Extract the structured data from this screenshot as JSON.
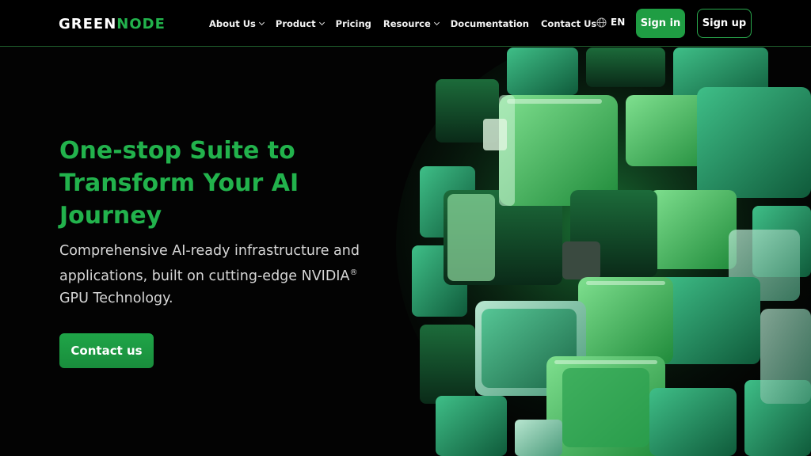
{
  "brand": {
    "logo_part1": "GREEN",
    "logo_part2": "NODE"
  },
  "nav": {
    "items": [
      {
        "label": "About Us",
        "dropdown": true
      },
      {
        "label": "Product",
        "dropdown": true
      },
      {
        "label": "Pricing",
        "dropdown": false
      },
      {
        "label": "Resource",
        "dropdown": true
      },
      {
        "label": "Documentation",
        "dropdown": false
      },
      {
        "label": "Contact Us",
        "dropdown": false
      }
    ]
  },
  "header": {
    "language": "EN",
    "signin_label": "Sign in",
    "signup_label": "Sign up"
  },
  "hero": {
    "title": "One-stop Suite to Transform Your AI Journey",
    "description_line1": "Comprehensive AI-ready infrastructure and",
    "description_line2": "applications, built on cutting-edge NVIDIA",
    "registered_mark": "®",
    "description_line3": "GPU Technology.",
    "cta_label": "Contact us"
  },
  "icons": {
    "language": "globe-icon",
    "dropdown": "chevron-down-icon"
  },
  "colors": {
    "accent": "#22b24c",
    "button": "#1f9d43",
    "background": "#030303"
  }
}
